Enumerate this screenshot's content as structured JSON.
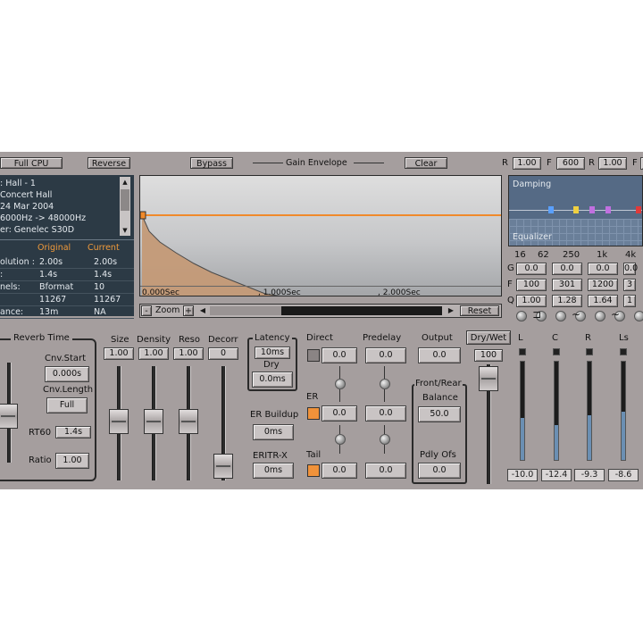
{
  "toolbar": {
    "full_cpu": "Full CPU",
    "reverse": "Reverse",
    "bypass": "Bypass",
    "gain_envelope": "Gain Envelope",
    "clear": "Clear",
    "r1_label": "R",
    "r1_value": "1.00",
    "f_label": "F",
    "f_value": "600",
    "r2_label": "R",
    "r2_value": "1.00",
    "f2_label": "F"
  },
  "info": {
    "line1": ": Hall - 1",
    "line2": "Concert Hall",
    "line3": "24 Mar 2004",
    "line4": "6000Hz -> 48000Hz",
    "line5": "er: Genelec S30D",
    "col_original": "Original",
    "col_current": "Current",
    "rows": [
      {
        "label": "olution :",
        "original": "2.00s",
        "current": "2.00s"
      },
      {
        "label": ":",
        "original": "1.4s",
        "current": "1.4s"
      },
      {
        "label": "nels:",
        "original": "Bformat",
        "current": "10"
      },
      {
        "label": "",
        "original": "11267",
        "current": "11267"
      },
      {
        "label": "ance:",
        "original": "13m",
        "current": "NA"
      }
    ]
  },
  "graph": {
    "tick0": "0.000Sec",
    "tick1": ", 1.000Sec",
    "tick2": ", 2.000Sec",
    "zoom_label": "Zoom",
    "zoom_minus": "-",
    "zoom_plus": "+",
    "reset": "Reset"
  },
  "eq": {
    "damping": "Damping",
    "equalizer": "Equalizer",
    "freqs": [
      "16",
      "62",
      "250",
      "1k",
      "4k"
    ],
    "g_label": "G",
    "f_label": "F",
    "q_label": "Q",
    "g_values": [
      "0.0",
      "0.0",
      "0.0",
      "0.0"
    ],
    "f_values": [
      "100",
      "301",
      "1200",
      "3"
    ],
    "q_values": [
      "1.00",
      "1.28",
      "1.64",
      "1"
    ]
  },
  "reverb": {
    "title": "Reverb Time",
    "cnv_start_label": "Cnv.Start",
    "cnv_start_value": "0.000s",
    "cnv_length_label": "Cnv.Length",
    "cnv_length_value": "Full",
    "rt60_label": "RT60",
    "rt60_value": "1.4s",
    "ratio_label": "Ratio",
    "ratio_value": "1.00"
  },
  "faders": {
    "size_label": "Size",
    "size_value": "1.00",
    "density_label": "Density",
    "density_value": "1.00",
    "reso_label": "Reso",
    "reso_value": "1.00",
    "decorr_label": "Decorr",
    "decorr_value": "0"
  },
  "latency": {
    "title": "Latency",
    "value": "10ms",
    "dry_label": "Dry",
    "dry_value": "0.0ms"
  },
  "er": {
    "buildup_label": "ER Buildup",
    "buildup_value": "0ms",
    "eritr_label": "ERITR-X",
    "eritr_value": "0ms"
  },
  "mix": {
    "direct_label": "Direct",
    "direct_value": "0.0",
    "predelay_label": "Predelay",
    "predelay_value": "0.0",
    "output_label": "Output",
    "output_value": "0.0",
    "drywet_label": "Dry/Wet",
    "drywet_value": "100",
    "er_label": "ER",
    "er_value": "0.0",
    "er_value2": "0.0",
    "tail_label": "Tail",
    "tail_value": "0.0",
    "tail_value2": "0.0",
    "front_rear_label": "Front/Rear",
    "balance_label": "Balance",
    "balance_value": "50.0",
    "pdly_label": "Pdly Ofs",
    "pdly_value": "0.0"
  },
  "meters": [
    {
      "label": "L",
      "value": "-10.0",
      "level": 0.42
    },
    {
      "label": "C",
      "value": "-12.4",
      "level": 0.35
    },
    {
      "label": "R",
      "value": "-9.3",
      "level": 0.45
    },
    {
      "label": "Ls",
      "value": "-8.6",
      "level": 0.48
    }
  ],
  "colors": {
    "panel": "#a59e9e",
    "envelope": "#f08a2a",
    "meter_fill": "#6b8fb3",
    "info_bg": "#2c3a45",
    "eq_bg": "#556a85"
  }
}
